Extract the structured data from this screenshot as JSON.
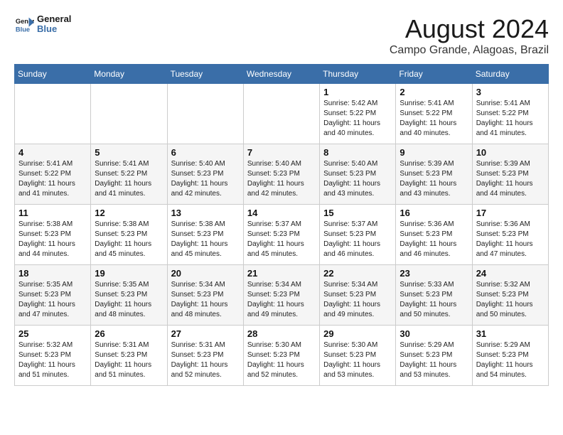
{
  "header": {
    "logo_line1": "General",
    "logo_line2": "Blue",
    "main_title": "August 2024",
    "subtitle": "Campo Grande, Alagoas, Brazil"
  },
  "weekdays": [
    "Sunday",
    "Monday",
    "Tuesday",
    "Wednesday",
    "Thursday",
    "Friday",
    "Saturday"
  ],
  "weeks": [
    [
      {
        "day": "",
        "info": ""
      },
      {
        "day": "",
        "info": ""
      },
      {
        "day": "",
        "info": ""
      },
      {
        "day": "",
        "info": ""
      },
      {
        "day": "1",
        "info": "Sunrise: 5:42 AM\nSunset: 5:22 PM\nDaylight: 11 hours and 40 minutes."
      },
      {
        "day": "2",
        "info": "Sunrise: 5:41 AM\nSunset: 5:22 PM\nDaylight: 11 hours and 40 minutes."
      },
      {
        "day": "3",
        "info": "Sunrise: 5:41 AM\nSunset: 5:22 PM\nDaylight: 11 hours and 41 minutes."
      }
    ],
    [
      {
        "day": "4",
        "info": "Sunrise: 5:41 AM\nSunset: 5:22 PM\nDaylight: 11 hours and 41 minutes."
      },
      {
        "day": "5",
        "info": "Sunrise: 5:41 AM\nSunset: 5:22 PM\nDaylight: 11 hours and 41 minutes."
      },
      {
        "day": "6",
        "info": "Sunrise: 5:40 AM\nSunset: 5:23 PM\nDaylight: 11 hours and 42 minutes."
      },
      {
        "day": "7",
        "info": "Sunrise: 5:40 AM\nSunset: 5:23 PM\nDaylight: 11 hours and 42 minutes."
      },
      {
        "day": "8",
        "info": "Sunrise: 5:40 AM\nSunset: 5:23 PM\nDaylight: 11 hours and 43 minutes."
      },
      {
        "day": "9",
        "info": "Sunrise: 5:39 AM\nSunset: 5:23 PM\nDaylight: 11 hours and 43 minutes."
      },
      {
        "day": "10",
        "info": "Sunrise: 5:39 AM\nSunset: 5:23 PM\nDaylight: 11 hours and 44 minutes."
      }
    ],
    [
      {
        "day": "11",
        "info": "Sunrise: 5:38 AM\nSunset: 5:23 PM\nDaylight: 11 hours and 44 minutes."
      },
      {
        "day": "12",
        "info": "Sunrise: 5:38 AM\nSunset: 5:23 PM\nDaylight: 11 hours and 45 minutes."
      },
      {
        "day": "13",
        "info": "Sunrise: 5:38 AM\nSunset: 5:23 PM\nDaylight: 11 hours and 45 minutes."
      },
      {
        "day": "14",
        "info": "Sunrise: 5:37 AM\nSunset: 5:23 PM\nDaylight: 11 hours and 45 minutes."
      },
      {
        "day": "15",
        "info": "Sunrise: 5:37 AM\nSunset: 5:23 PM\nDaylight: 11 hours and 46 minutes."
      },
      {
        "day": "16",
        "info": "Sunrise: 5:36 AM\nSunset: 5:23 PM\nDaylight: 11 hours and 46 minutes."
      },
      {
        "day": "17",
        "info": "Sunrise: 5:36 AM\nSunset: 5:23 PM\nDaylight: 11 hours and 47 minutes."
      }
    ],
    [
      {
        "day": "18",
        "info": "Sunrise: 5:35 AM\nSunset: 5:23 PM\nDaylight: 11 hours and 47 minutes."
      },
      {
        "day": "19",
        "info": "Sunrise: 5:35 AM\nSunset: 5:23 PM\nDaylight: 11 hours and 48 minutes."
      },
      {
        "day": "20",
        "info": "Sunrise: 5:34 AM\nSunset: 5:23 PM\nDaylight: 11 hours and 48 minutes."
      },
      {
        "day": "21",
        "info": "Sunrise: 5:34 AM\nSunset: 5:23 PM\nDaylight: 11 hours and 49 minutes."
      },
      {
        "day": "22",
        "info": "Sunrise: 5:34 AM\nSunset: 5:23 PM\nDaylight: 11 hours and 49 minutes."
      },
      {
        "day": "23",
        "info": "Sunrise: 5:33 AM\nSunset: 5:23 PM\nDaylight: 11 hours and 50 minutes."
      },
      {
        "day": "24",
        "info": "Sunrise: 5:32 AM\nSunset: 5:23 PM\nDaylight: 11 hours and 50 minutes."
      }
    ],
    [
      {
        "day": "25",
        "info": "Sunrise: 5:32 AM\nSunset: 5:23 PM\nDaylight: 11 hours and 51 minutes."
      },
      {
        "day": "26",
        "info": "Sunrise: 5:31 AM\nSunset: 5:23 PM\nDaylight: 11 hours and 51 minutes."
      },
      {
        "day": "27",
        "info": "Sunrise: 5:31 AM\nSunset: 5:23 PM\nDaylight: 11 hours and 52 minutes."
      },
      {
        "day": "28",
        "info": "Sunrise: 5:30 AM\nSunset: 5:23 PM\nDaylight: 11 hours and 52 minutes."
      },
      {
        "day": "29",
        "info": "Sunrise: 5:30 AM\nSunset: 5:23 PM\nDaylight: 11 hours and 53 minutes."
      },
      {
        "day": "30",
        "info": "Sunrise: 5:29 AM\nSunset: 5:23 PM\nDaylight: 11 hours and 53 minutes."
      },
      {
        "day": "31",
        "info": "Sunrise: 5:29 AM\nSunset: 5:23 PM\nDaylight: 11 hours and 54 minutes."
      }
    ]
  ]
}
